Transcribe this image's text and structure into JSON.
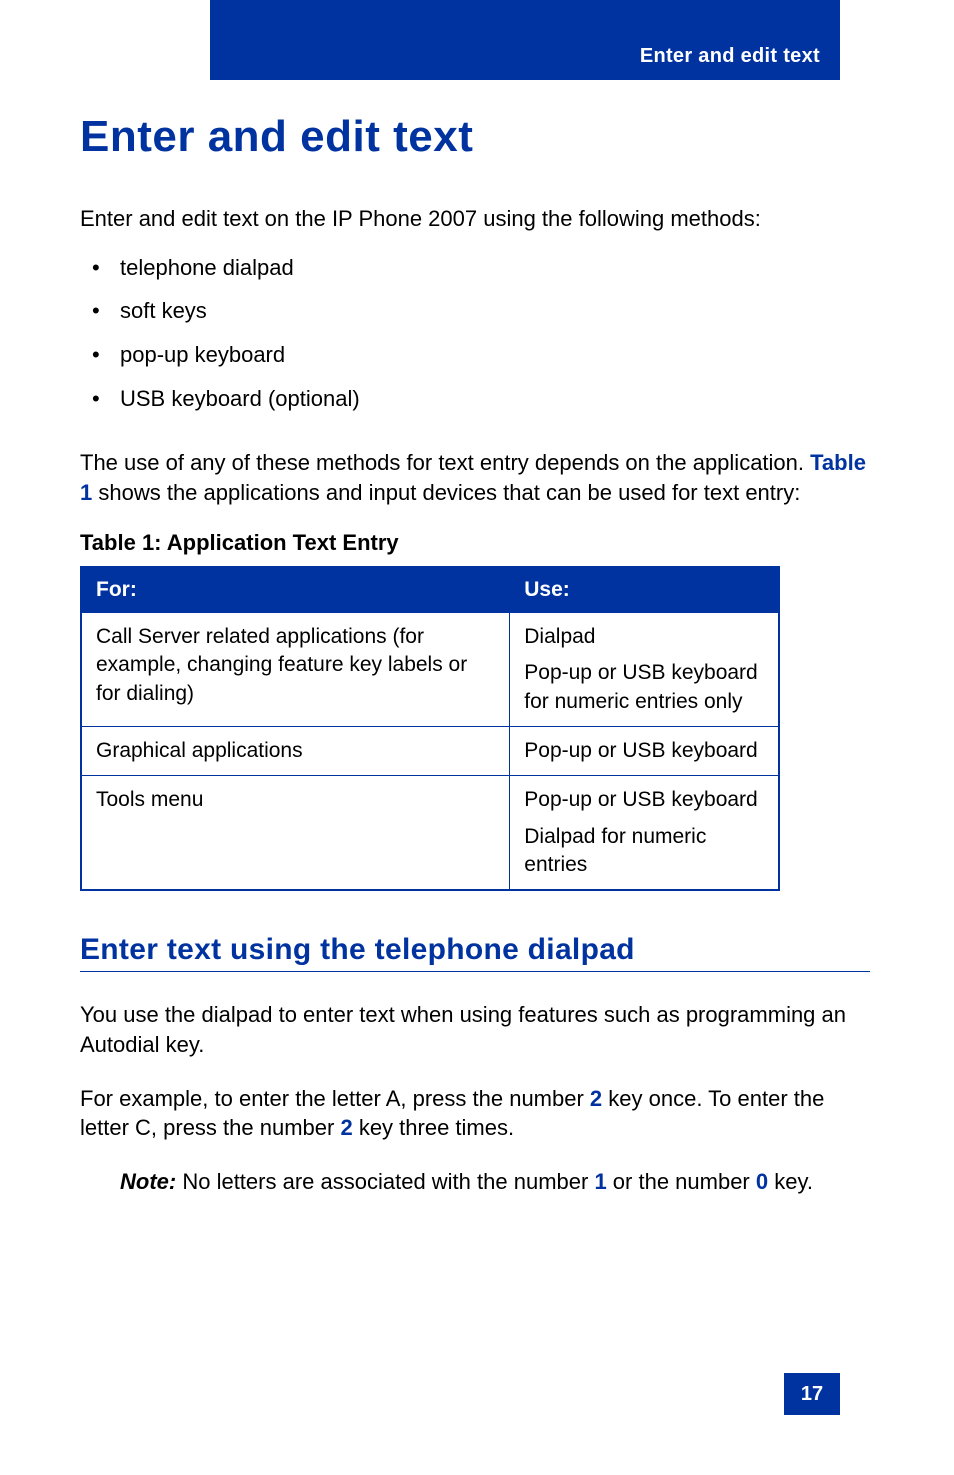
{
  "header": {
    "running_title": "Enter and edit text"
  },
  "h1": "Enter and edit text",
  "intro": "Enter and edit text on the IP Phone 2007 using the following methods:",
  "methods": [
    "telephone dialpad",
    "soft keys",
    "pop-up keyboard",
    "USB keyboard (optional)"
  ],
  "para2": {
    "pre": "The use of any of these methods for text entry depends on the applica­tion.  ",
    "link": "Table 1",
    "post": " shows the applications and input devices that can be used for text entry:"
  },
  "table": {
    "label": "Table 1: Application Text Entry",
    "head": {
      "c0": "For:",
      "c1": "Use:"
    },
    "rows": [
      {
        "c0": "Call Server related applications (for example, changing feature key labels or for dialing)",
        "c1a": "Dialpad",
        "c1b": "Pop-up or USB keyboard for numeric entries only"
      },
      {
        "c0": "Graphical applications",
        "c1a": "Pop-up or USB keyboard",
        "c1b": ""
      },
      {
        "c0": "Tools menu",
        "c1a": "Pop-up or USB keyboard",
        "c1b": "Dialpad for numeric entries"
      }
    ]
  },
  "h2": "Enter text using the telephone dialpad",
  "para3": "You use the dialpad to enter text when using features such as programming an Autodial key.",
  "para4": {
    "s1": "For example, to enter the letter A, press the number ",
    "n1": "2",
    "s2": " key once. To enter the letter C, press the number ",
    "n2": "2",
    "s3": " key three times."
  },
  "note": {
    "label": "Note:",
    "s1": " No letters are associated with the number ",
    "n1": "1",
    "s2": " or the number ",
    "n2": "0",
    "s3": " key."
  },
  "page_number": "17",
  "chart_data": {
    "type": "table",
    "title": "Table 1: Application Text Entry",
    "columns": [
      "For:",
      "Use:"
    ],
    "rows": [
      [
        "Call Server related applications (for example, changing feature key labels or for dialing)",
        "Dialpad; Pop-up or USB keyboard for numeric entries only"
      ],
      [
        "Graphical applications",
        "Pop-up or USB keyboard"
      ],
      [
        "Tools menu",
        "Pop-up or USB keyboard; Dialpad for numeric entries"
      ]
    ]
  }
}
